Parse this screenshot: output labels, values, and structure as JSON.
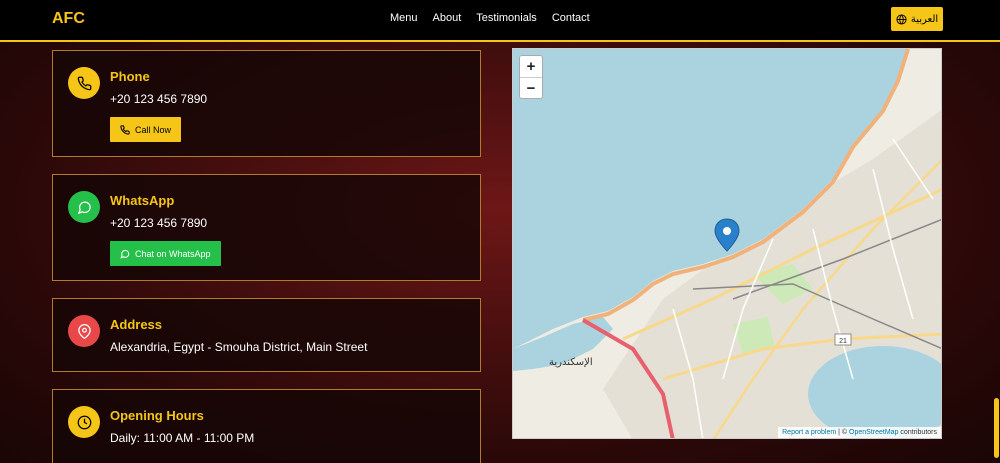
{
  "navbar": {
    "brand": "AFC",
    "links": [
      "Menu",
      "About",
      "Testimonials",
      "Contact"
    ],
    "language_label": "العربية"
  },
  "contact_cards": [
    {
      "title": "Phone",
      "text": "+20 123 456 7890",
      "button": "Call Now",
      "icon": "phone-icon",
      "icon_color": "#f5c518"
    },
    {
      "title": "WhatsApp",
      "text": "+20 123 456 7890",
      "button": "Chat on WhatsApp",
      "icon": "whatsapp-icon",
      "icon_color": "#25c04a"
    },
    {
      "title": "Address",
      "text": "Alexandria, Egypt - Smouha District, Main Street",
      "icon": "map-pin-icon",
      "icon_color": "#e94848"
    },
    {
      "title": "Opening Hours",
      "text": "Daily: 11:00 AM - 11:00 PM",
      "icon": "clock-icon",
      "icon_color": "#f5c518"
    }
  ],
  "map": {
    "zoom_in": "+",
    "zoom_out": "−",
    "city_label": "الإسكندرية",
    "road_number": "21",
    "attribution_report": "Report a problem",
    "attribution_separator": "| ©",
    "attribution_osm": "OpenStreetMap",
    "attribution_suffix": "contributors"
  },
  "colors": {
    "accent": "#f5c518",
    "whatsapp": "#25c04a",
    "address": "#e94848"
  }
}
